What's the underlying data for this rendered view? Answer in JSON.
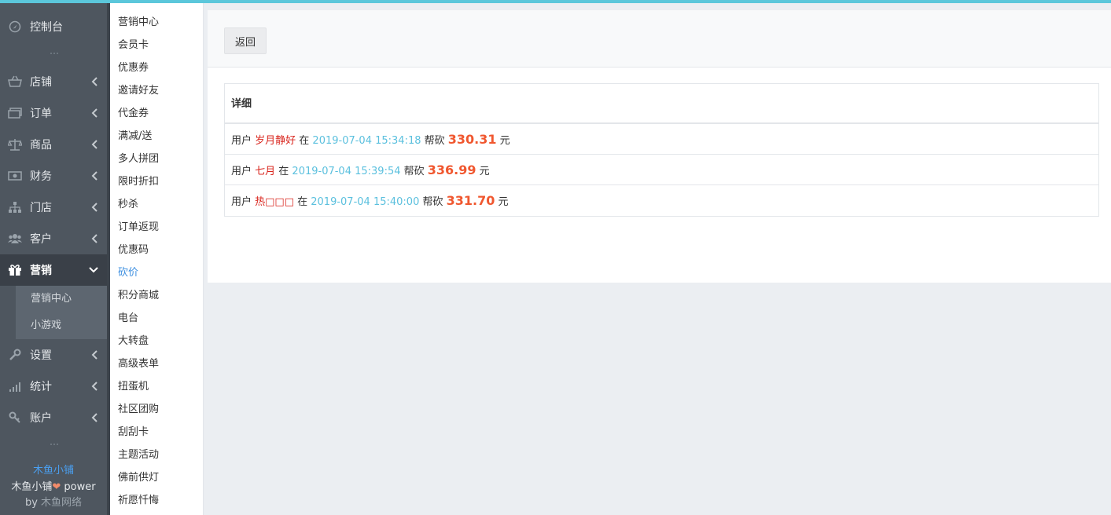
{
  "colors": {
    "accent_bar": "#5bc7db",
    "sidebar_bg": "#4e565f",
    "link_blue": "#3d8fe0",
    "nickname_red": "#d9251d",
    "time_cyan": "#5bc0de",
    "amount_orange": "#f0572f"
  },
  "sidebar": {
    "items": [
      {
        "label": "控制台",
        "icon": "dashboard-icon"
      },
      {
        "label": "店铺",
        "icon": "basket-icon"
      },
      {
        "label": "订单",
        "icon": "money-icon"
      },
      {
        "label": "商品",
        "icon": "balance-scale-icon"
      },
      {
        "label": "财务",
        "icon": "cash-icon"
      },
      {
        "label": "门店",
        "icon": "sitemap-icon"
      },
      {
        "label": "客户",
        "icon": "users-icon"
      },
      {
        "label": "营销",
        "icon": "gift-icon",
        "active": true
      },
      {
        "label": "设置",
        "icon": "wrench-icon"
      },
      {
        "label": "统计",
        "icon": "signal-icon"
      },
      {
        "label": "账户",
        "icon": "key-icon"
      }
    ],
    "submenu": [
      "营销中心",
      "小游戏"
    ],
    "footer": {
      "brand": "木鱼小铺",
      "power_prefix": "木鱼小铺",
      "power_suffix": " power",
      "by_prefix": "by ",
      "by_name": "木鱼网络"
    }
  },
  "menu2": {
    "items": [
      "营销中心",
      "会员卡",
      "优惠券",
      "邀请好友",
      "代金券",
      "满减/送",
      "多人拼团",
      "限时折扣",
      "秒杀",
      "订单返现",
      "优惠码",
      "砍价",
      "积分商城",
      "电台",
      "大转盘",
      "高级表单",
      "扭蛋机",
      "社区团购",
      "刮刮卡",
      "主题活动",
      "佛前供灯",
      "祈愿忏悔"
    ],
    "active_index": 11
  },
  "main": {
    "back_label": "返回",
    "table_header": "详细",
    "rows": [
      {
        "user_prefix": "用户 ",
        "nickname": "岁月静好",
        "at": " 在 ",
        "time": "2019-07-04 15:34:18",
        "action": " 帮砍 ",
        "amount": "330.31",
        "unit": " 元"
      },
      {
        "user_prefix": "用户 ",
        "nickname": "七月",
        "at": " 在 ",
        "time": "2019-07-04 15:39:54",
        "action": " 帮砍 ",
        "amount": "336.99",
        "unit": " 元"
      },
      {
        "user_prefix": "用户 ",
        "nickname": "热□□□",
        "at": " 在 ",
        "time": "2019-07-04 15:40:00",
        "action": " 帮砍 ",
        "amount": "331.70",
        "unit": " 元"
      }
    ]
  }
}
